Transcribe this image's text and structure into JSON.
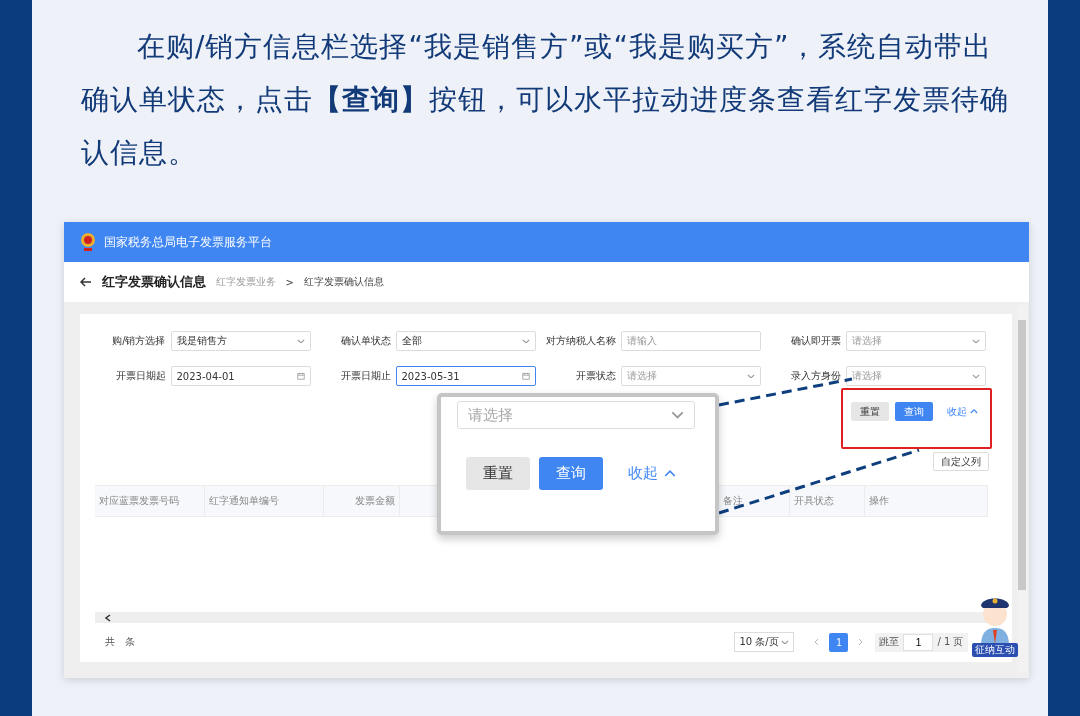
{
  "intro": "在购/销方信息栏选择“我是销售方”或“我是购买方”，系统自动带出确认单状态，点击**【查询】**按钮，可以水平拉动进度条查看红字发票待确认信息。",
  "app": {
    "title": "国家税务总局电子发票服务平台",
    "page_title": "红字发票确认信息",
    "breadcrumb": [
      "红字发票业务",
      "红字发票确认信息"
    ],
    "breadcrumb_separator": ">",
    "filters": [
      {
        "label": "购/销方选择",
        "kind": "select",
        "value": "我是销售方",
        "focused": false
      },
      {
        "label": "确认单状态",
        "kind": "select",
        "value": "全部",
        "focused": false
      },
      {
        "label": "对方纳税人名称",
        "kind": "input",
        "placeholder": "请输入",
        "focused": false
      },
      {
        "label": "确认即开票",
        "kind": "select",
        "placeholder": "请选择",
        "focused": false
      },
      {
        "label": "开票日期起",
        "kind": "date",
        "value": "2023-04-01",
        "focused": false
      },
      {
        "label": "开票日期止",
        "kind": "date",
        "value": "2023-05-31",
        "focused": true
      },
      {
        "label": "开票状态",
        "kind": "select",
        "placeholder": "请选择",
        "focused": false
      },
      {
        "label": "录入方身份",
        "kind": "select",
        "placeholder": "请选择",
        "focused": false
      }
    ],
    "reset": "重置",
    "query": "查询",
    "collapse": "收起",
    "custom_columns": "自定义列",
    "columns": [
      "对应蓝票发票号码",
      "红字通知单编号",
      "发票金额",
      "备注",
      "开具状态",
      "操作"
    ],
    "total": "共　条",
    "page_size": "10 条/页",
    "pages": [
      {
        "label": "1",
        "selected": true
      }
    ],
    "jump_label": "跳至",
    "jump_value": "1",
    "page_count": "/ 1 页"
  },
  "magnifier": {
    "placeholder": "请选择",
    "reset": "重置",
    "query": "查询",
    "collapse": "收起"
  },
  "mascot": {
    "badge": "征纳互动"
  }
}
